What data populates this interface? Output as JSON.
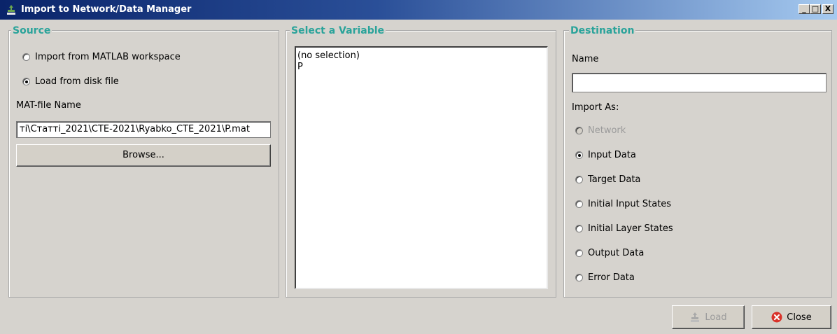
{
  "window": {
    "title": "Import to Network/Data Manager",
    "controls": {
      "minimize": "_",
      "maximize": "□",
      "close": "X"
    }
  },
  "source": {
    "legend": "Source",
    "options": [
      {
        "label": "Import from MATLAB workspace",
        "selected": false
      },
      {
        "label": "Load from disk file",
        "selected": true
      }
    ],
    "file_label": "MAT-file Name",
    "file_value": "ті\\Статті_2021\\CTE-2021\\Ryabko_CTE_2021\\P.mat",
    "browse_label": "Browse..."
  },
  "variable": {
    "legend": "Select a Variable",
    "items": [
      "(no selection)",
      "P"
    ]
  },
  "destination": {
    "legend": "Destination",
    "name_label": "Name",
    "name_value": "",
    "import_as_label": "Import As:",
    "options": [
      {
        "label": "Network",
        "selected": false,
        "enabled": false
      },
      {
        "label": "Input Data",
        "selected": true,
        "enabled": true
      },
      {
        "label": "Target Data",
        "selected": false,
        "enabled": true
      },
      {
        "label": "Initial Input States",
        "selected": false,
        "enabled": true
      },
      {
        "label": "Initial Layer States",
        "selected": false,
        "enabled": true
      },
      {
        "label": "Output Data",
        "selected": false,
        "enabled": true
      },
      {
        "label": "Error Data",
        "selected": false,
        "enabled": true
      }
    ]
  },
  "footer": {
    "load_label": "Load",
    "close_label": "Close"
  },
  "colors": {
    "titlebar": "#0a246a",
    "legend": "#2aa39a",
    "close_icon": "#d9322a"
  },
  "icons": {
    "app": "neural-network-icon",
    "load": "load-icon",
    "close": "close-icon"
  }
}
